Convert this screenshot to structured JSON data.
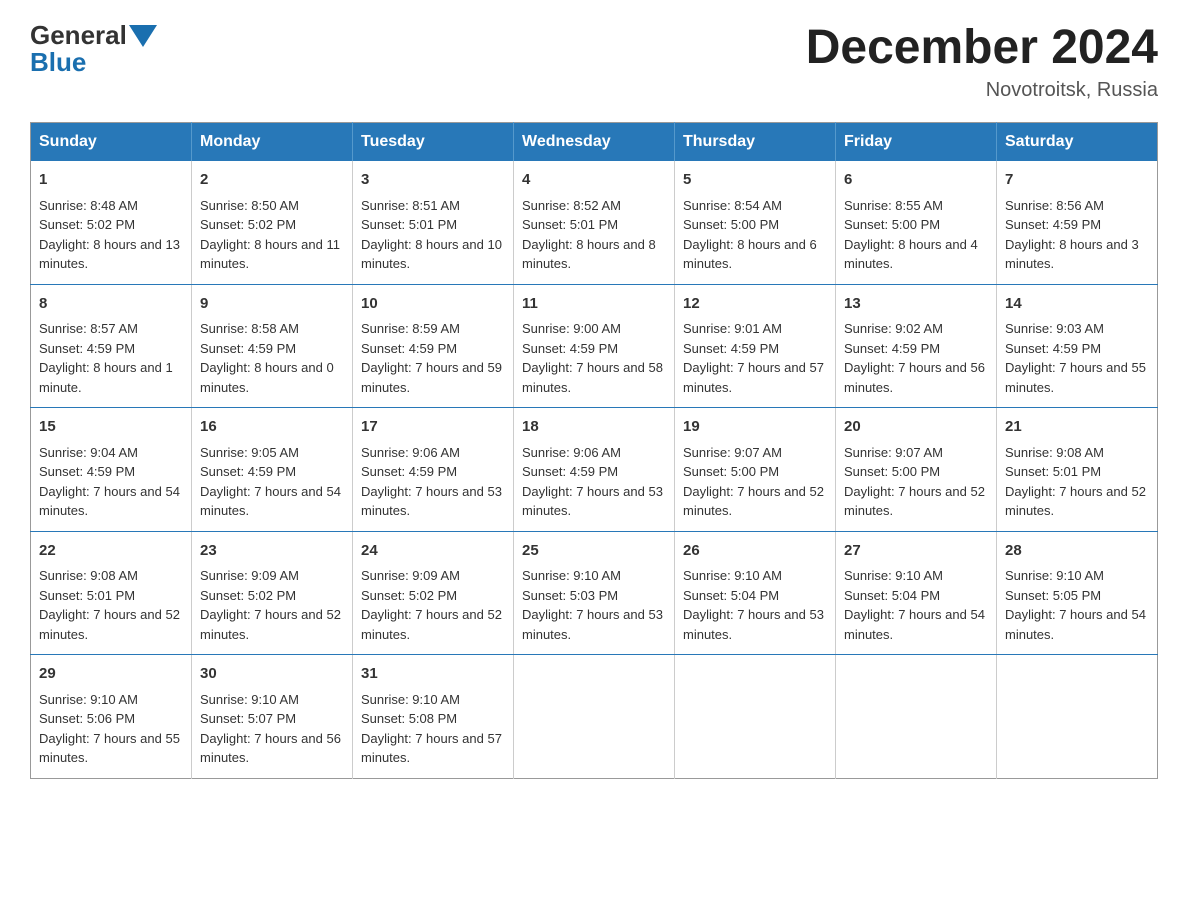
{
  "header": {
    "logo_line1": "General",
    "logo_line2": "Blue",
    "month_title": "December 2024",
    "location": "Novotroitsk, Russia"
  },
  "weekdays": [
    "Sunday",
    "Monday",
    "Tuesday",
    "Wednesday",
    "Thursday",
    "Friday",
    "Saturday"
  ],
  "weeks": [
    [
      {
        "day": "1",
        "sunrise": "8:48 AM",
        "sunset": "5:02 PM",
        "daylight": "8 hours and 13 minutes."
      },
      {
        "day": "2",
        "sunrise": "8:50 AM",
        "sunset": "5:02 PM",
        "daylight": "8 hours and 11 minutes."
      },
      {
        "day": "3",
        "sunrise": "8:51 AM",
        "sunset": "5:01 PM",
        "daylight": "8 hours and 10 minutes."
      },
      {
        "day": "4",
        "sunrise": "8:52 AM",
        "sunset": "5:01 PM",
        "daylight": "8 hours and 8 minutes."
      },
      {
        "day": "5",
        "sunrise": "8:54 AM",
        "sunset": "5:00 PM",
        "daylight": "8 hours and 6 minutes."
      },
      {
        "day": "6",
        "sunrise": "8:55 AM",
        "sunset": "5:00 PM",
        "daylight": "8 hours and 4 minutes."
      },
      {
        "day": "7",
        "sunrise": "8:56 AM",
        "sunset": "4:59 PM",
        "daylight": "8 hours and 3 minutes."
      }
    ],
    [
      {
        "day": "8",
        "sunrise": "8:57 AM",
        "sunset": "4:59 PM",
        "daylight": "8 hours and 1 minute."
      },
      {
        "day": "9",
        "sunrise": "8:58 AM",
        "sunset": "4:59 PM",
        "daylight": "8 hours and 0 minutes."
      },
      {
        "day": "10",
        "sunrise": "8:59 AM",
        "sunset": "4:59 PM",
        "daylight": "7 hours and 59 minutes."
      },
      {
        "day": "11",
        "sunrise": "9:00 AM",
        "sunset": "4:59 PM",
        "daylight": "7 hours and 58 minutes."
      },
      {
        "day": "12",
        "sunrise": "9:01 AM",
        "sunset": "4:59 PM",
        "daylight": "7 hours and 57 minutes."
      },
      {
        "day": "13",
        "sunrise": "9:02 AM",
        "sunset": "4:59 PM",
        "daylight": "7 hours and 56 minutes."
      },
      {
        "day": "14",
        "sunrise": "9:03 AM",
        "sunset": "4:59 PM",
        "daylight": "7 hours and 55 minutes."
      }
    ],
    [
      {
        "day": "15",
        "sunrise": "9:04 AM",
        "sunset": "4:59 PM",
        "daylight": "7 hours and 54 minutes."
      },
      {
        "day": "16",
        "sunrise": "9:05 AM",
        "sunset": "4:59 PM",
        "daylight": "7 hours and 54 minutes."
      },
      {
        "day": "17",
        "sunrise": "9:06 AM",
        "sunset": "4:59 PM",
        "daylight": "7 hours and 53 minutes."
      },
      {
        "day": "18",
        "sunrise": "9:06 AM",
        "sunset": "4:59 PM",
        "daylight": "7 hours and 53 minutes."
      },
      {
        "day": "19",
        "sunrise": "9:07 AM",
        "sunset": "5:00 PM",
        "daylight": "7 hours and 52 minutes."
      },
      {
        "day": "20",
        "sunrise": "9:07 AM",
        "sunset": "5:00 PM",
        "daylight": "7 hours and 52 minutes."
      },
      {
        "day": "21",
        "sunrise": "9:08 AM",
        "sunset": "5:01 PM",
        "daylight": "7 hours and 52 minutes."
      }
    ],
    [
      {
        "day": "22",
        "sunrise": "9:08 AM",
        "sunset": "5:01 PM",
        "daylight": "7 hours and 52 minutes."
      },
      {
        "day": "23",
        "sunrise": "9:09 AM",
        "sunset": "5:02 PM",
        "daylight": "7 hours and 52 minutes."
      },
      {
        "day": "24",
        "sunrise": "9:09 AM",
        "sunset": "5:02 PM",
        "daylight": "7 hours and 52 minutes."
      },
      {
        "day": "25",
        "sunrise": "9:10 AM",
        "sunset": "5:03 PM",
        "daylight": "7 hours and 53 minutes."
      },
      {
        "day": "26",
        "sunrise": "9:10 AM",
        "sunset": "5:04 PM",
        "daylight": "7 hours and 53 minutes."
      },
      {
        "day": "27",
        "sunrise": "9:10 AM",
        "sunset": "5:04 PM",
        "daylight": "7 hours and 54 minutes."
      },
      {
        "day": "28",
        "sunrise": "9:10 AM",
        "sunset": "5:05 PM",
        "daylight": "7 hours and 54 minutes."
      }
    ],
    [
      {
        "day": "29",
        "sunrise": "9:10 AM",
        "sunset": "5:06 PM",
        "daylight": "7 hours and 55 minutes."
      },
      {
        "day": "30",
        "sunrise": "9:10 AM",
        "sunset": "5:07 PM",
        "daylight": "7 hours and 56 minutes."
      },
      {
        "day": "31",
        "sunrise": "9:10 AM",
        "sunset": "5:08 PM",
        "daylight": "7 hours and 57 minutes."
      },
      null,
      null,
      null,
      null
    ]
  ],
  "labels": {
    "sunrise": "Sunrise:",
    "sunset": "Sunset:",
    "daylight": "Daylight:"
  }
}
